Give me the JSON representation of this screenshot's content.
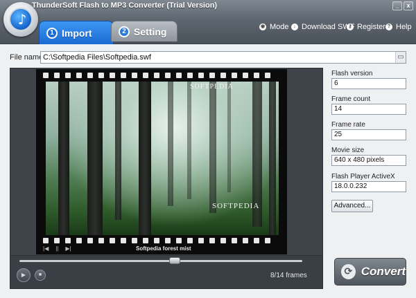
{
  "window": {
    "title": "ThunderSoft Flash to MP3 Converter (Trial Version)",
    "minimize_label": "_",
    "close_label": "x"
  },
  "tabs": [
    {
      "number": "1",
      "label": "Import"
    },
    {
      "number": "2",
      "label": "Setting"
    }
  ],
  "menu": [
    {
      "label": "Mode",
      "icon": "mode-icon"
    },
    {
      "label": "Download SWF",
      "icon": "download-icon"
    },
    {
      "label": "Register",
      "icon": "key-icon"
    },
    {
      "label": "Help",
      "icon": "help-icon"
    }
  ],
  "file": {
    "label": "File name",
    "path": "C:\\Softpedia Files\\Softpedia.swf"
  },
  "preview": {
    "watermark": "SOFTPEDIA",
    "image_logo": "SOFTPEDIA",
    "caption": "Softpedia forest mist",
    "frames": "8/14 frames",
    "seek_position": 0.55
  },
  "info": {
    "flash_version": {
      "label": "Flash version",
      "value": "6"
    },
    "frame_count": {
      "label": "Frame count",
      "value": "14"
    },
    "frame_rate": {
      "label": "Frame rate",
      "value": "25"
    },
    "movie_size": {
      "label": "Movie size",
      "value": "640 x 480 pixels"
    },
    "flash_player": {
      "label": "Flash Player ActiveX",
      "value": "18.0.0.232"
    }
  },
  "buttons": {
    "advanced": "Advanced...",
    "convert": "Convert"
  }
}
